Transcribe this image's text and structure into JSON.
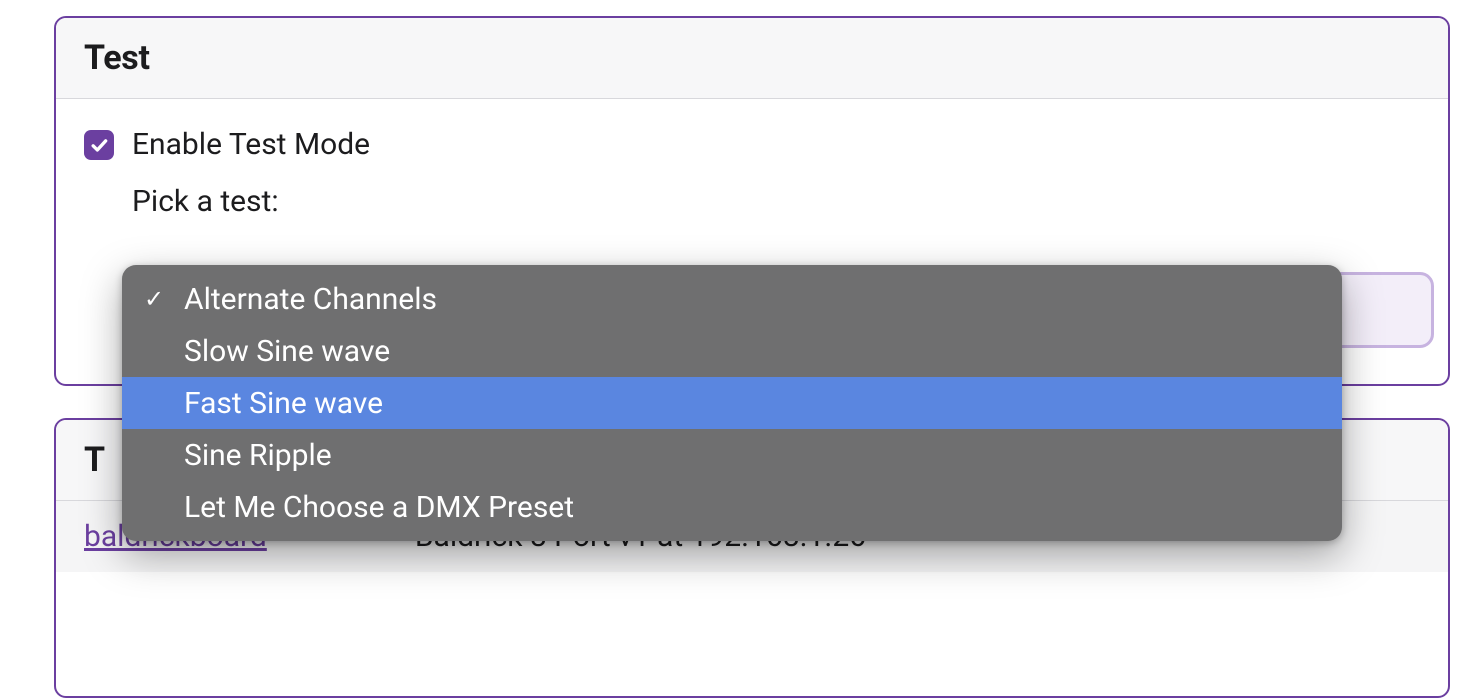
{
  "test_panel": {
    "title": "Test",
    "enable_label": "Enable Test Mode",
    "enabled": true,
    "pick_label": "Pick a test:"
  },
  "dropdown": {
    "items": [
      {
        "label": "Alternate Channels",
        "checked": true,
        "highlighted": false
      },
      {
        "label": "Slow Sine wave",
        "checked": false,
        "highlighted": false
      },
      {
        "label": "Fast Sine wave",
        "checked": false,
        "highlighted": true
      },
      {
        "label": "Sine Ripple",
        "checked": false,
        "highlighted": false
      },
      {
        "label": "Let Me Choose a DMX Preset",
        "checked": false,
        "highlighted": false
      }
    ]
  },
  "second_panel": {
    "title_partial": "T",
    "link": "baldrickboard",
    "description": "Baldrick 8 Port v1 at 192.168.1.26"
  }
}
